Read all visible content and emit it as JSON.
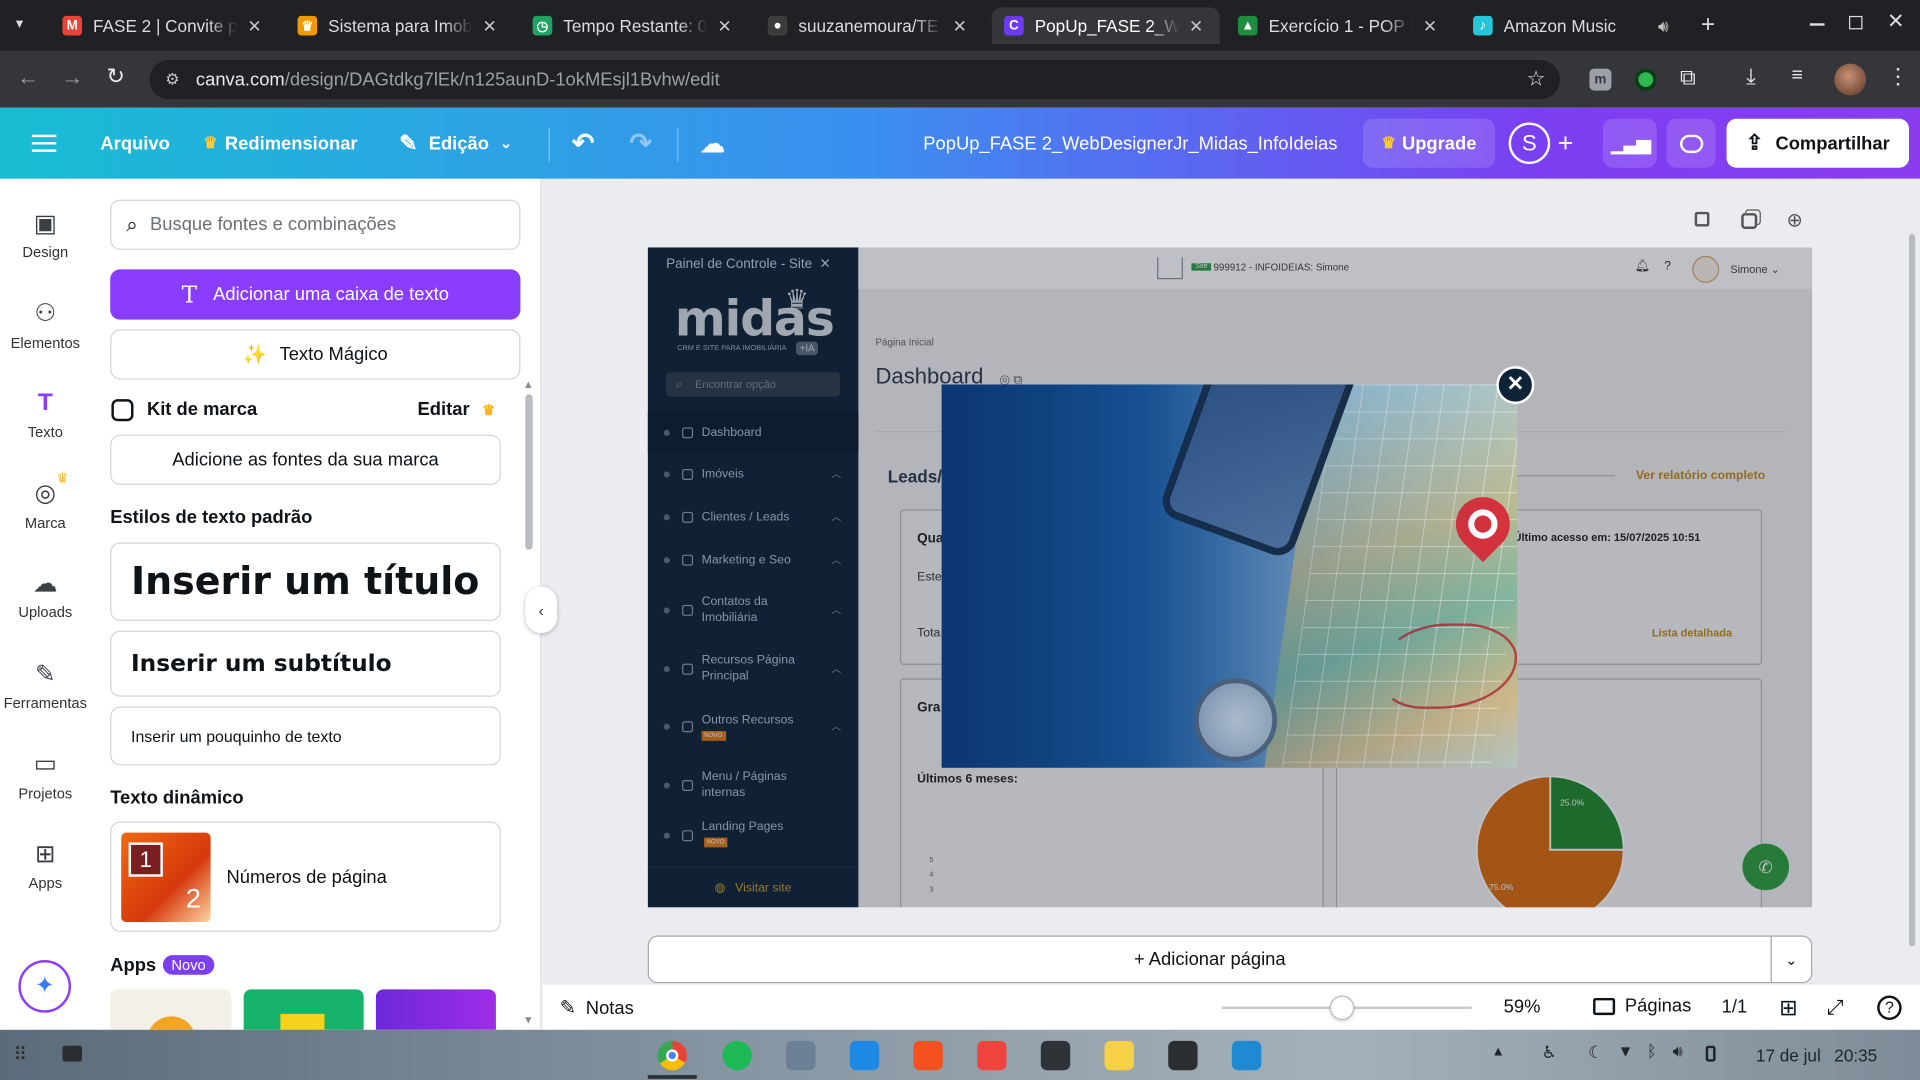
{
  "browser": {
    "tabs": [
      {
        "title": "FASE 2 | Convite p",
        "icon_color": "#ea4335",
        "icon": "gmail-icon",
        "glyph": "M"
      },
      {
        "title": "Sistema para Imobi",
        "icon_color": "#f29900",
        "icon": "crown-icon",
        "glyph": "♛"
      },
      {
        "title": "Tempo Restante: 0",
        "icon_color": "#1ea362",
        "icon": "timer-icon",
        "glyph": "◷"
      },
      {
        "title": "suuzanemoura/TE",
        "icon_color": "#3c3c3c",
        "icon": "github-icon",
        "glyph": "●"
      },
      {
        "title": "PopUp_FASE 2_We",
        "icon_color": "#6b3af2",
        "icon": "canva-icon",
        "glyph": "C",
        "active": true
      },
      {
        "title": "Exercício 1 - POP U",
        "icon_color": "#1e8e3e",
        "icon": "drive-icon",
        "glyph": "▲"
      },
      {
        "title": "Amazon Music",
        "icon_color": "#26c6da",
        "icon": "amazon-music-icon",
        "glyph": "♪"
      }
    ],
    "url_domain": "canva.com",
    "url_path": "/design/DAGtdkg7lEk/n125aunD-1okMEsjl1Bvhw/edit"
  },
  "canva": {
    "menu": {
      "file": "Arquivo",
      "resize": "Redimensionar",
      "edit": "Edição",
      "doc_title": "PopUp_FASE 2_WebDesignerJr_Midas_InfoIdeias",
      "upgrade": "Upgrade",
      "avatar": "S",
      "share": "Compartilhar"
    },
    "rail": [
      {
        "label": "Design",
        "icon": "design-icon"
      },
      {
        "label": "Elementos",
        "icon": "elements-icon"
      },
      {
        "label": "Texto",
        "icon": "text-icon"
      },
      {
        "label": "Marca",
        "icon": "brand-icon"
      },
      {
        "label": "Uploads",
        "icon": "upload-icon"
      },
      {
        "label": "Ferramentas",
        "icon": "tools-icon"
      },
      {
        "label": "Projetos",
        "icon": "folder-icon"
      },
      {
        "label": "Apps",
        "icon": "apps-icon"
      }
    ],
    "panel": {
      "search_placeholder": "Busque fontes e combinações",
      "add_textbox": "Adicionar uma caixa de texto",
      "magic_text": "Texto Mágico",
      "brand_kit": "Kit de marca",
      "brand_edit": "Editar",
      "add_brand_fonts": "Adicione as fontes da sua marca",
      "default_styles": "Estilos de texto padrão",
      "heading": "Inserir um título",
      "subheading": "Inserir um subtítulo",
      "body": "Inserir um pouquinho de texto",
      "dynamic_text": "Texto dinâmico",
      "page_numbers": "Números de página",
      "apps": "Apps",
      "apps_badge": "Novo"
    },
    "bottom": {
      "add_page": "+ Adicionar página",
      "notes": "Notas",
      "zoom": "59%",
      "zoom_level": 0.59,
      "pages": "Páginas",
      "page_count": "1/1"
    }
  },
  "design": {
    "sidebar_title": "Painel de Controle - Site",
    "logo_text": "midas",
    "logo_sub": "CRM E SITE PARA IMOBILIÁRIA",
    "logo_badge": "+IA",
    "search_placeholder": "Encontrar opção",
    "menu": [
      {
        "label": "Dashboard",
        "caret": false
      },
      {
        "label": "Imóveis",
        "caret": true
      },
      {
        "label": "Clientes / Leads",
        "caret": true
      },
      {
        "label": "Marketing e Seo",
        "caret": true
      },
      {
        "label": "Contatos da Imobiliária",
        "caret": true
      },
      {
        "label": "Recursos Página Principal",
        "caret": true
      },
      {
        "label": "Outros Recursos",
        "caret": true,
        "badge": "NOVO"
      },
      {
        "label": "Menu / Páginas internas",
        "caret": false
      },
      {
        "label": "Landing Pages",
        "caret": false,
        "badge": "NOVO"
      }
    ],
    "visit_site": "Visitar site",
    "topbar_id": "999912 - INFOIDEIAS: Simone",
    "topbar_badge": "Site",
    "user_name": "Simone",
    "breadcrumb": "Página Inicial",
    "page_title": "Dashboard",
    "leads_title": "Leads/",
    "full_report": "Ver relatório completo",
    "card_qua": "Qua",
    "card_este": "Este",
    "card_tota": "Tota",
    "last_access": "Último acesso em: 15/07/2025 10:51",
    "detailed_list": "Lista detalhada",
    "card_gra": "Gra",
    "last_6_months": "Últimos 6 meses:",
    "axis_ticks": [
      "5",
      "4",
      "3"
    ],
    "pie_small": "25.0%",
    "pie_large": "75.0%",
    "pie_values": [
      25,
      75
    ],
    "pie_colors": [
      "#1f8a2c",
      "#d96b0b"
    ]
  },
  "taskbar": {
    "date": "17 de jul",
    "time": "20:35"
  },
  "colors": {
    "canva_purple": "#8b3dff",
    "sidebar_dark": "#0f2338",
    "midas_gold": "#caa224"
  }
}
